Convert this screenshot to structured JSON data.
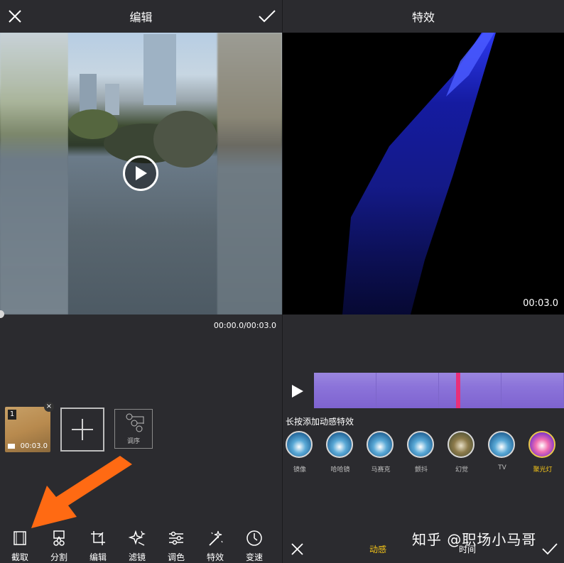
{
  "left": {
    "title": "编辑",
    "time_display": "00:00.0/00:03.0",
    "clip": {
      "index": "1",
      "duration": "00:03.0"
    },
    "reorder_label": "调序",
    "toolbar": [
      {
        "label": "截取",
        "icon": "crop-frame-icon"
      },
      {
        "label": "分割",
        "icon": "scissors-icon"
      },
      {
        "label": "编辑",
        "icon": "edit-crop-icon"
      },
      {
        "label": "滤镜",
        "icon": "sparkle-filter-icon"
      },
      {
        "label": "调色",
        "icon": "sliders-icon"
      },
      {
        "label": "特效",
        "icon": "magic-wand-icon"
      },
      {
        "label": "变速",
        "icon": "speed-gauge-icon"
      }
    ]
  },
  "right": {
    "title": "特效",
    "time_display": "00:03.0",
    "hint": "长按添加动感特效",
    "effects": [
      {
        "label": "镜像"
      },
      {
        "label": "哈哈镜"
      },
      {
        "label": "马赛克"
      },
      {
        "label": "颤抖"
      },
      {
        "label": "幻觉"
      },
      {
        "label": "TV"
      },
      {
        "label": "聚光灯"
      }
    ],
    "active_effect": "聚光灯",
    "tabs": {
      "dynamic": "动感",
      "time": "时间"
    }
  },
  "watermark": "知乎 @职场小马哥",
  "colors": {
    "background": "#2b2b2f",
    "accent": "#f5c518",
    "arrow": "#ff6a13",
    "playhead": "#e8307a",
    "timeline": "#8a6fd8"
  }
}
